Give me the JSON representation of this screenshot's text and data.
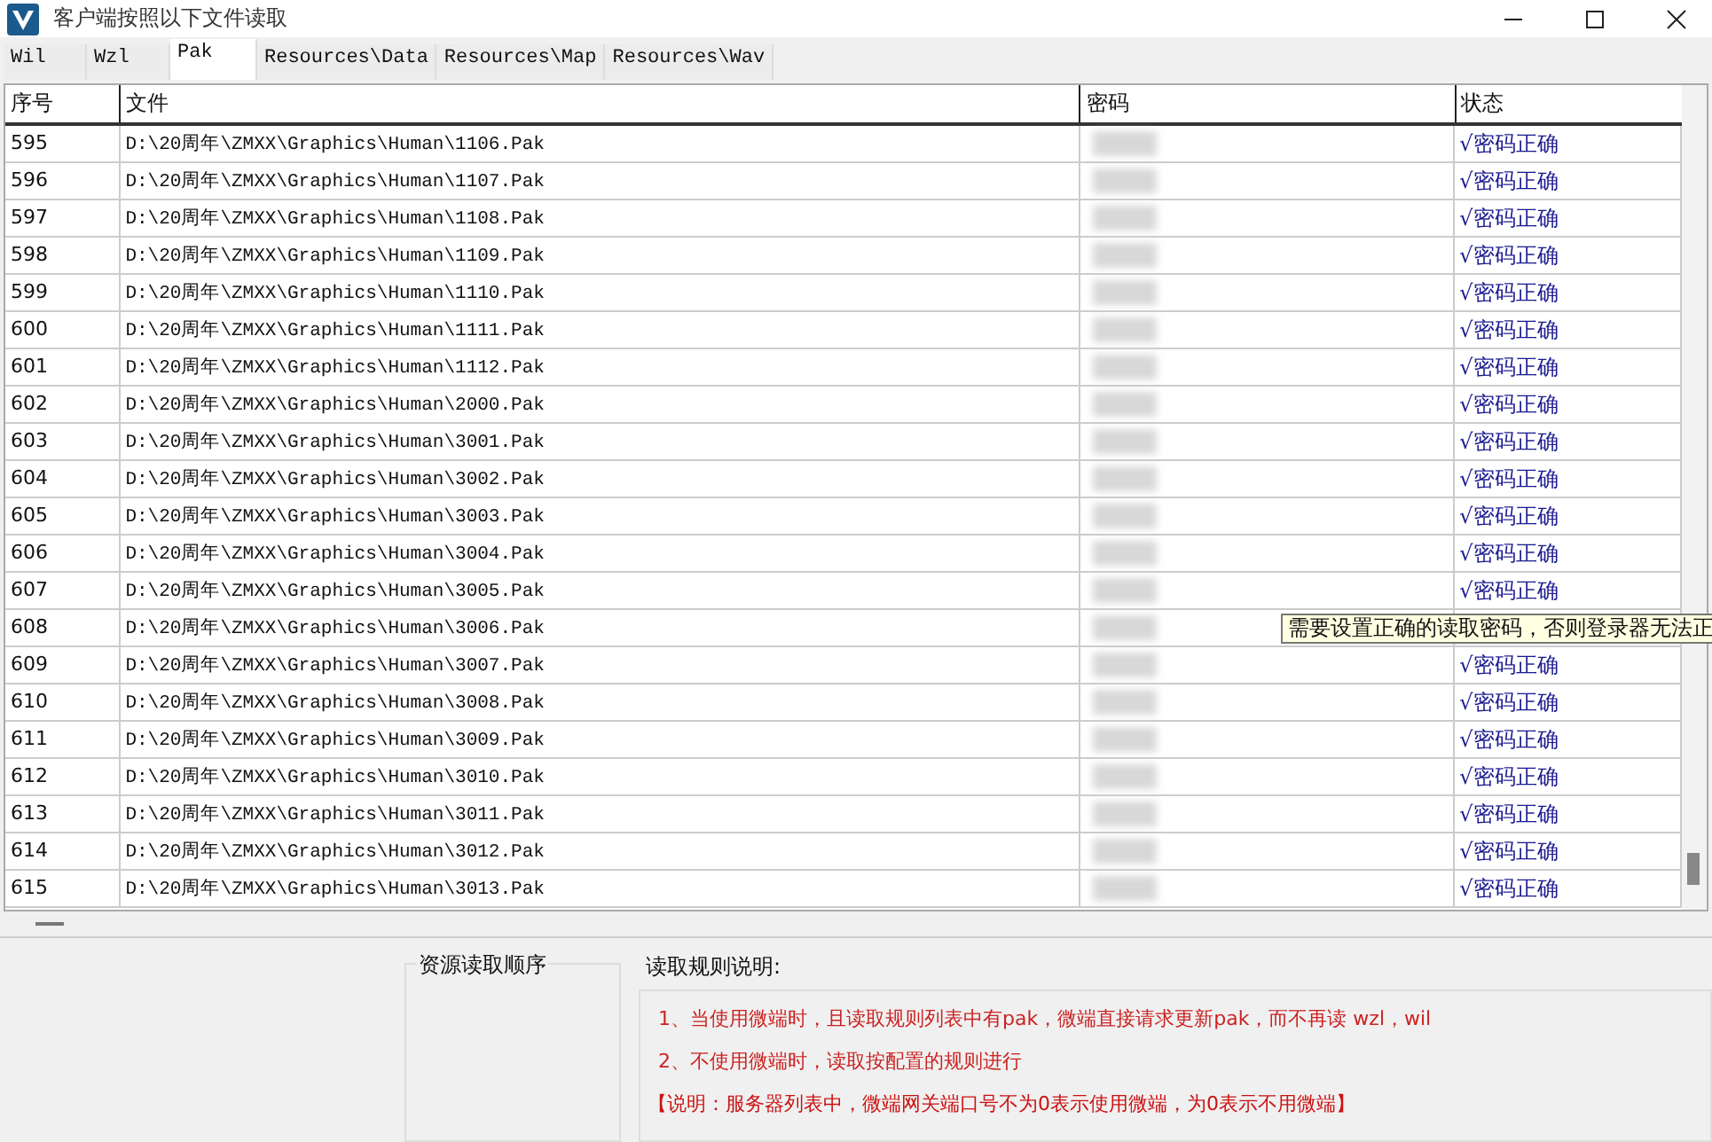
{
  "window": {
    "title": "客户端按照以下文件读取"
  },
  "tabs": [
    {
      "label": "Wil",
      "selected": false
    },
    {
      "label": "Wzl",
      "selected": false
    },
    {
      "label": "Pak",
      "selected": true
    },
    {
      "label": "Resources\\Data",
      "selected": false
    },
    {
      "label": "Resources\\Map",
      "selected": false
    },
    {
      "label": "Resources\\Wav",
      "selected": false
    }
  ],
  "table": {
    "columns": [
      "序号",
      "文件",
      "密码",
      "状态"
    ],
    "rows": [
      {
        "index": "595",
        "file": "D:\\20周年\\ZMXX\\Graphics\\Human\\1106.Pak",
        "status": "√密码正确"
      },
      {
        "index": "596",
        "file": "D:\\20周年\\ZMXX\\Graphics\\Human\\1107.Pak",
        "status": "√密码正确"
      },
      {
        "index": "597",
        "file": "D:\\20周年\\ZMXX\\Graphics\\Human\\1108.Pak",
        "status": "√密码正确"
      },
      {
        "index": "598",
        "file": "D:\\20周年\\ZMXX\\Graphics\\Human\\1109.Pak",
        "status": "√密码正确"
      },
      {
        "index": "599",
        "file": "D:\\20周年\\ZMXX\\Graphics\\Human\\1110.Pak",
        "status": "√密码正确"
      },
      {
        "index": "600",
        "file": "D:\\20周年\\ZMXX\\Graphics\\Human\\1111.Pak",
        "status": "√密码正确"
      },
      {
        "index": "601",
        "file": "D:\\20周年\\ZMXX\\Graphics\\Human\\1112.Pak",
        "status": "√密码正确"
      },
      {
        "index": "602",
        "file": "D:\\20周年\\ZMXX\\Graphics\\Human\\2000.Pak",
        "status": "√密码正确"
      },
      {
        "index": "603",
        "file": "D:\\20周年\\ZMXX\\Graphics\\Human\\3001.Pak",
        "status": "√密码正确"
      },
      {
        "index": "604",
        "file": "D:\\20周年\\ZMXX\\Graphics\\Human\\3002.Pak",
        "status": "√密码正确"
      },
      {
        "index": "605",
        "file": "D:\\20周年\\ZMXX\\Graphics\\Human\\3003.Pak",
        "status": "√密码正确"
      },
      {
        "index": "606",
        "file": "D:\\20周年\\ZMXX\\Graphics\\Human\\3004.Pak",
        "status": "√密码正确"
      },
      {
        "index": "607",
        "file": "D:\\20周年\\ZMXX\\Graphics\\Human\\3005.Pak",
        "status": "√密码正确"
      },
      {
        "index": "608",
        "file": "D:\\20周年\\ZMXX\\Graphics\\Human\\3006.Pak"
      },
      {
        "index": "609",
        "file": "D:\\20周年\\ZMXX\\Graphics\\Human\\3007.Pak",
        "status": "√密码正确"
      },
      {
        "index": "610",
        "file": "D:\\20周年\\ZMXX\\Graphics\\Human\\3008.Pak",
        "status": "√密码正确"
      },
      {
        "index": "611",
        "file": "D:\\20周年\\ZMXX\\Graphics\\Human\\3009.Pak",
        "status": "√密码正确"
      },
      {
        "index": "612",
        "file": "D:\\20周年\\ZMXX\\Graphics\\Human\\3010.Pak",
        "status": "√密码正确"
      },
      {
        "index": "613",
        "file": "D:\\20周年\\ZMXX\\Graphics\\Human\\3011.Pak",
        "status": "√密码正确"
      },
      {
        "index": "614",
        "file": "D:\\20周年\\ZMXX\\Graphics\\Human\\3012.Pak",
        "status": "√密码正确"
      },
      {
        "index": "615",
        "file": "D:\\20周年\\ZMXX\\Graphics\\Human\\3013.Pak",
        "status": "√密码正确"
      }
    ]
  },
  "tooltip": "需要设置正确的读取密码，否则登录器无法正",
  "order_panel": {
    "title": "资源读取顺序"
  },
  "rules_panel": {
    "title": "读取规则说明:",
    "lines": [
      "1、当使用微端时，且读取规则列表中有pak，微端直接请求更新pak，而不再读 wzl，wil",
      "2、不使用微端时，读取按配置的规则进行",
      "【说明：服务器列表中，微端网关端口号不为0表示使用微端，为0表示不用微端】"
    ]
  }
}
